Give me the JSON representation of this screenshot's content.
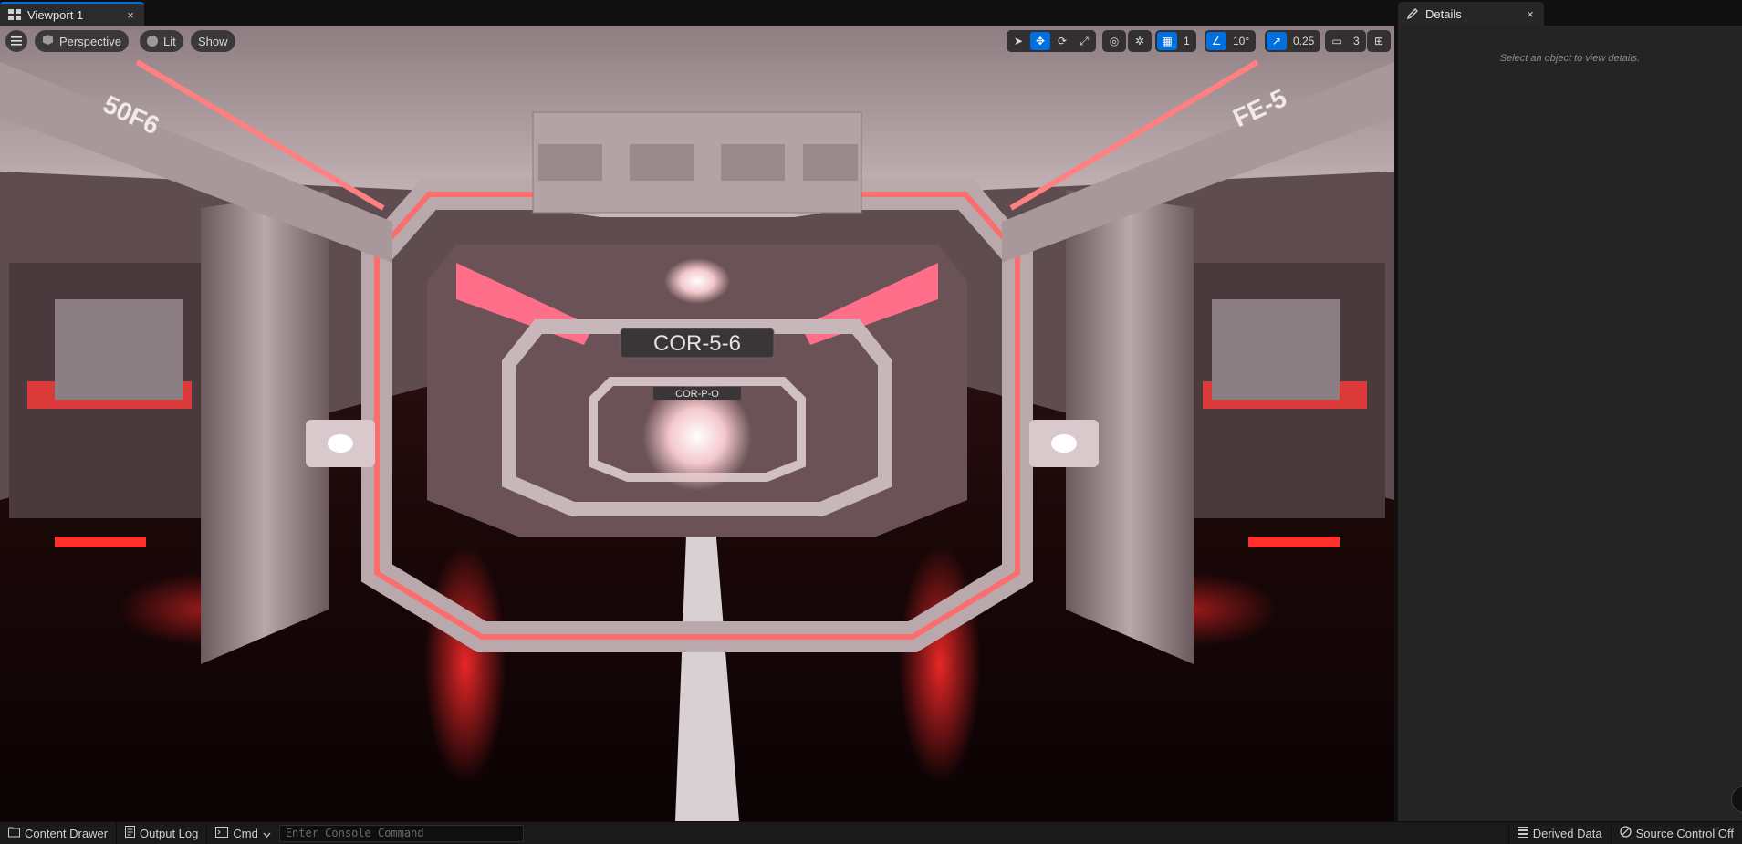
{
  "tabs": {
    "viewport_label": "Viewport 1",
    "details_label": "Details",
    "close_glyph": "×"
  },
  "viewport_toolbar": {
    "menu_icon": "hamburger-icon",
    "perspective_label": "Perspective",
    "lit_label": "Lit",
    "show_label": "Show",
    "grid_snap_value": "1",
    "rotation_snap_value": "10°",
    "scale_snap_value": "0.25",
    "camera_speed_value": "3",
    "accent_color": "#0070e0"
  },
  "scene": {
    "sign_main": "COR-5-6",
    "sign_secondary": "COR-P-O",
    "wall_text_left": "50F6",
    "wall_text_right": "FE-5"
  },
  "details": {
    "empty_hint": "Select an object to view details."
  },
  "statusbar": {
    "content_drawer_label": "Content Drawer",
    "output_log_label": "Output Log",
    "cmd_label": "Cmd",
    "console_placeholder": "Enter Console Command",
    "derived_data_label": "Derived Data",
    "source_control_label": "Source Control Off"
  }
}
